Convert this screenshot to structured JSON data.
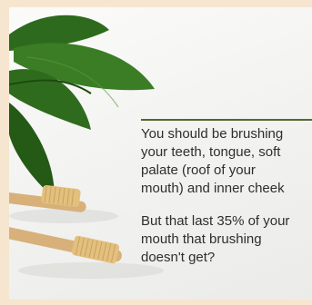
{
  "content": {
    "paragraph1": [
      "You should be brushing",
      "your teeth, tongue, soft",
      "palate (roof of your",
      "mouth) and inner cheek"
    ],
    "paragraph2": [
      "But that last 35% of your",
      "mouth that brushing",
      "doesn't get?"
    ]
  },
  "colors": {
    "frame": "#f6e6cf",
    "divider": "#4e6a2f",
    "leaf": "#2f6b1d",
    "bristles": "#e3c07d",
    "handle": "#d8b07a"
  }
}
